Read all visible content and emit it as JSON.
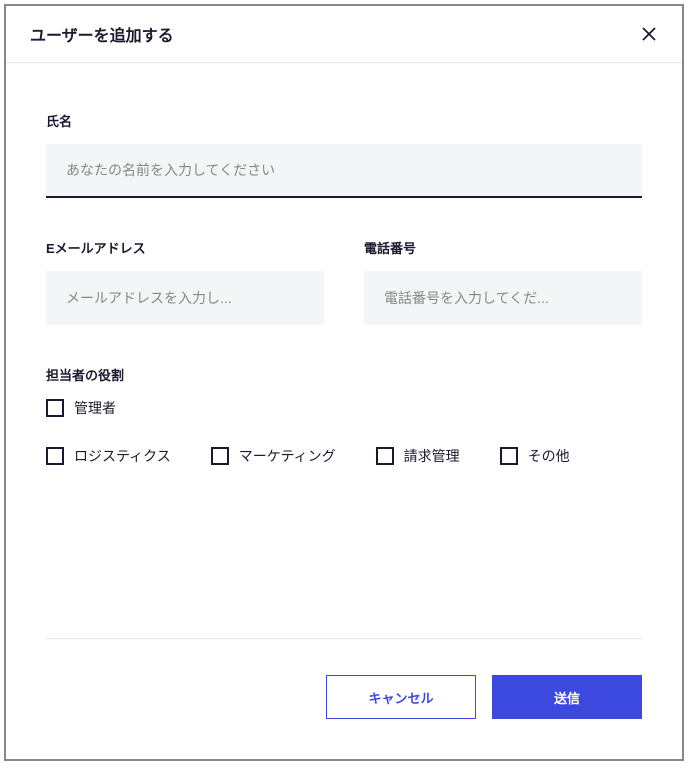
{
  "modal": {
    "title": "ユーザーを追加する"
  },
  "fields": {
    "name": {
      "label": "氏名",
      "placeholder": "あなたの名前を入力してください",
      "value": ""
    },
    "email": {
      "label": "Eメールアドレス",
      "placeholder": "メールアドレスを入力し...",
      "value": ""
    },
    "phone": {
      "label": "電話番号",
      "placeholder": "電話番号を入力してくだ...",
      "value": ""
    }
  },
  "roles": {
    "label": "担当者の役割",
    "options": {
      "admin": "管理者",
      "logistics": "ロジスティクス",
      "marketing": "マーケティング",
      "billing": "請求管理",
      "other": "その他"
    }
  },
  "actions": {
    "cancel": "キャンセル",
    "submit": "送信"
  }
}
